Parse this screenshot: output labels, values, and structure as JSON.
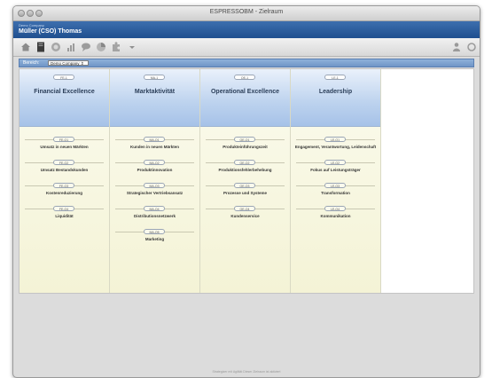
{
  "window": {
    "title": "ESPRESSOBM - Zielraum"
  },
  "app": {
    "company": "Demo Company",
    "user": "Müller (CSO) Thomas"
  },
  "toolbar": {
    "icons": [
      "home-icon",
      "document-icon",
      "globe-icon",
      "chart-icon",
      "speech-bubble-icon",
      "pie-chart-icon",
      "puzzle-icon",
      "dropdown-arrow-icon"
    ],
    "right_icons": [
      "person-icon",
      "refresh-icon"
    ]
  },
  "filter": {
    "label": "Bereich:",
    "value": "Demo Company ⇕"
  },
  "columns": [
    {
      "code": "FE-1",
      "title": "Financial Excellence",
      "objectives": [
        {
          "code": "FE-O1",
          "label": "Umsatz in neuen Märkten"
        },
        {
          "code": "FE-O2",
          "label": "Umsatz Bestandskunden"
        },
        {
          "code": "FE-O3",
          "label": "Kostenreduzierung"
        },
        {
          "code": "FE-O4",
          "label": "Liquidität"
        }
      ]
    },
    {
      "code": "MA-1",
      "title": "Marktaktivität",
      "objectives": [
        {
          "code": "MA-O1",
          "label": "Kunden in neuen Märkten"
        },
        {
          "code": "MA-O2",
          "label": "Produktinnovation"
        },
        {
          "code": "MA-O3",
          "label": "Strategischer Vertriebsansatz"
        },
        {
          "code": "MA-O4",
          "label": "Distributionsnetzwerk"
        },
        {
          "code": "MA-O5",
          "label": "Marketing"
        }
      ]
    },
    {
      "code": "OE-1",
      "title": "Operational Excellence",
      "objectives": [
        {
          "code": "OE-O1",
          "label": "Produkteinführungszeit"
        },
        {
          "code": "OE-O2",
          "label": "Produktionsfehlerbehebung"
        },
        {
          "code": "OE-O3",
          "label": "Prozesse und Systeme"
        },
        {
          "code": "OE-O4",
          "label": "Kundenservice"
        }
      ]
    },
    {
      "code": "LE-1",
      "title": "Leadership",
      "objectives": [
        {
          "code": "LE-O1",
          "label": "Engagement, Verantwortung, Leidenschaft"
        },
        {
          "code": "LE-O2",
          "label": "Fokus auf Leistungsträger"
        },
        {
          "code": "LE-O3",
          "label": "Transformation"
        },
        {
          "code": "LE-O4",
          "label": "Kommunikation"
        }
      ]
    }
  ],
  "status": {
    "text": "Strategizer mit Agilität Dieser Zielraum ist aktiviert"
  },
  "colors": {
    "header_blue": "#2a5c9c",
    "column_yellow": "#f6f5de",
    "column_head_blue": "#bcd2ee"
  }
}
